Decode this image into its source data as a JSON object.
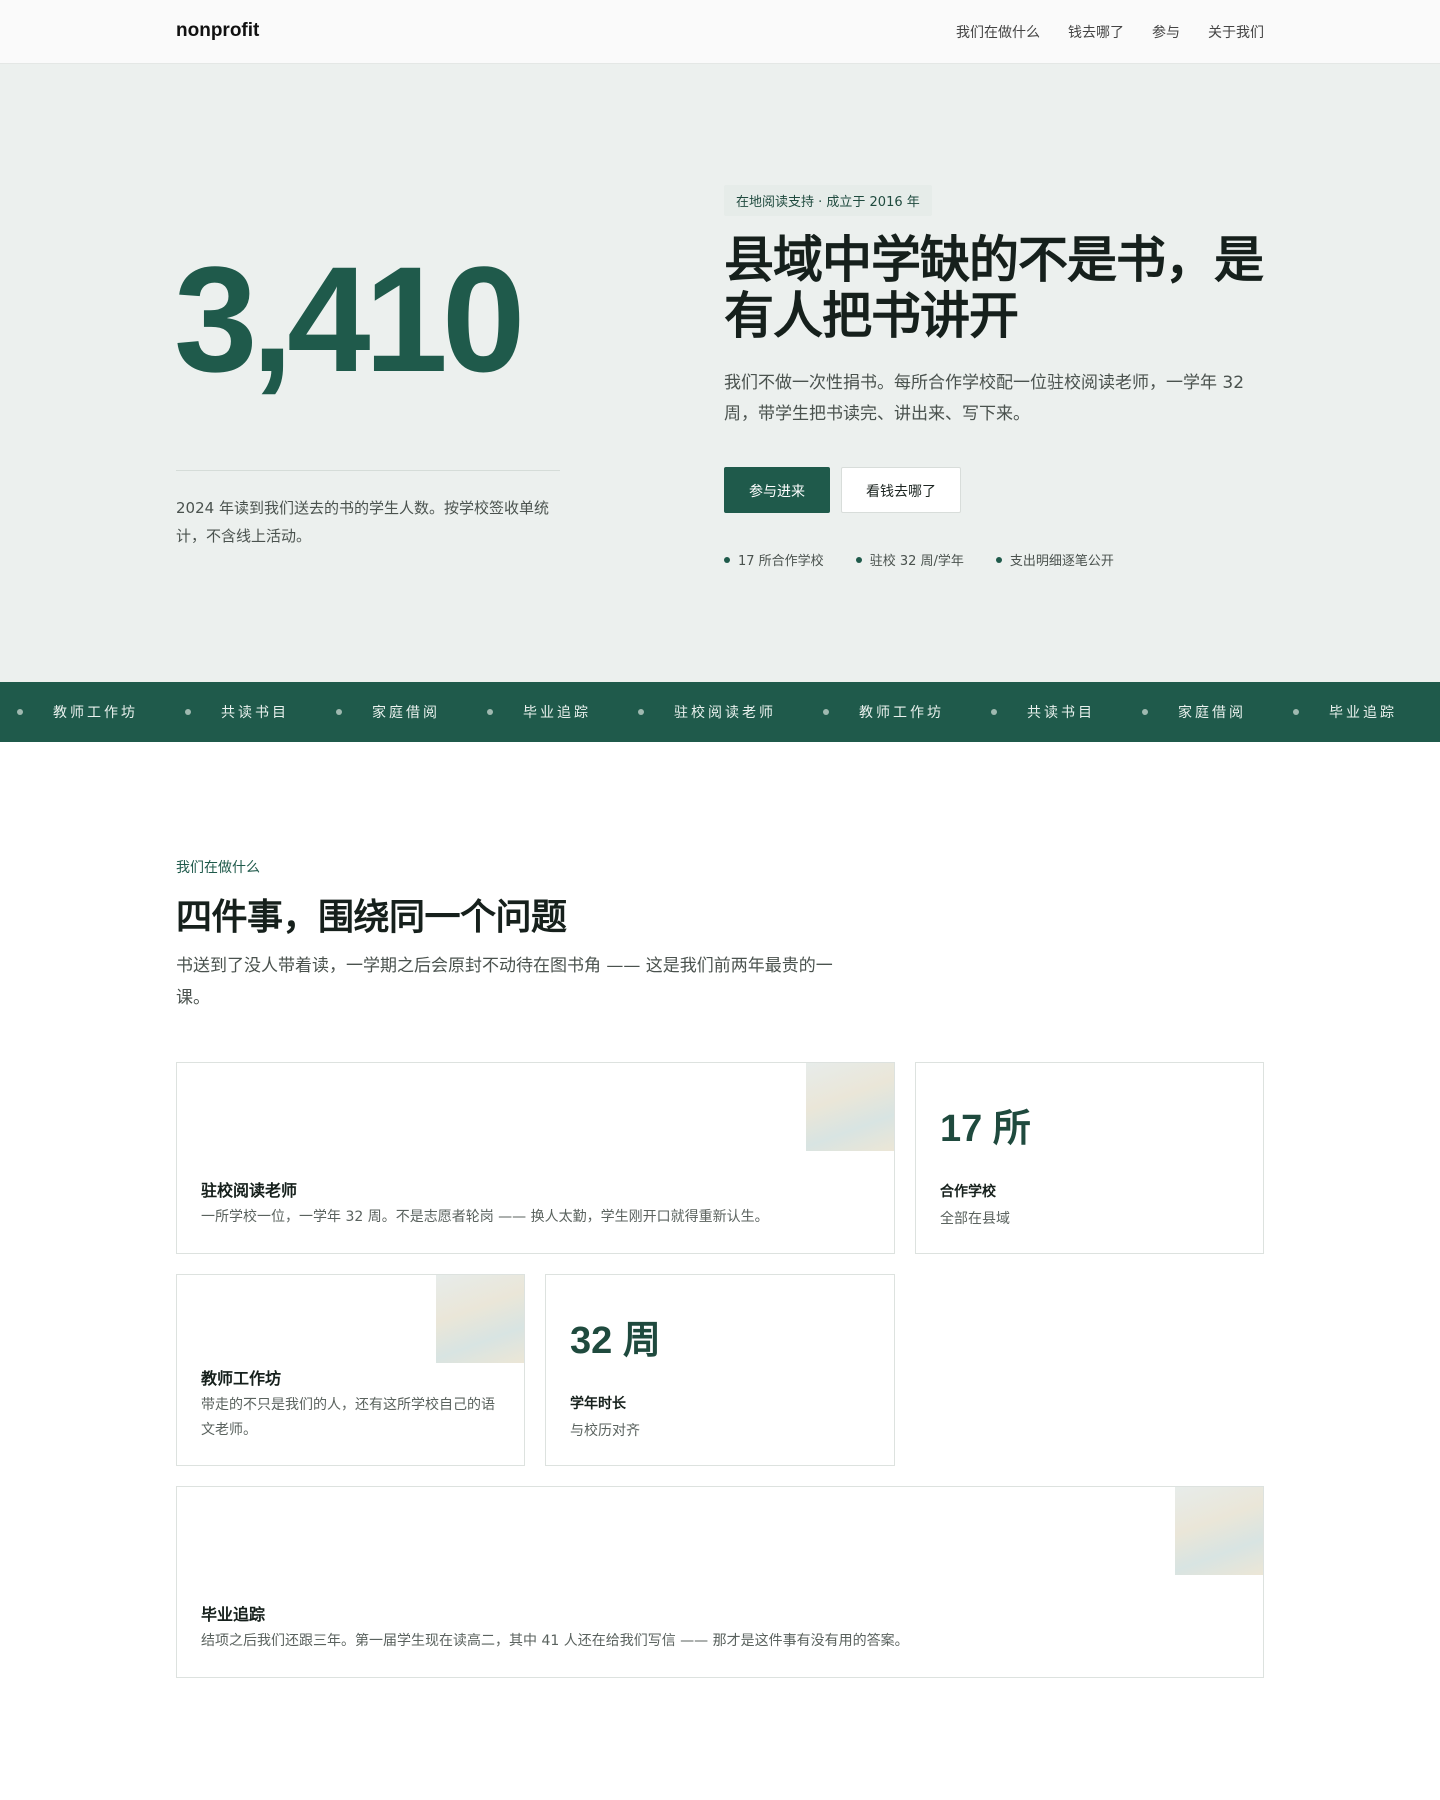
{
  "brand": "nonprofit",
  "nav": [
    "我们在做什么",
    "钱去哪了",
    "参与",
    "关于我们"
  ],
  "hero": {
    "number": "3,410",
    "number_caption": "2024 年读到我们送去的书的学生人数。按学校签收单统计，不含线上活动。",
    "eyebrow": "在地阅读支持 · 成立于 2016 年",
    "headline": "县域中学缺的不是书，是有人把书讲开",
    "lead": "我们不做一次性捐书。每所合作学校配一位驻校阅读老师，一学年 32 周，带学生把书读完、讲出来、写下来。",
    "primary_button": "参与进来",
    "secondary_button": "看钱去哪了",
    "facts": [
      "17 所合作学校",
      "驻校 32 周/学年",
      "支出明细逐笔公开"
    ]
  },
  "ticker": [
    "教师工作坊",
    "共读书目",
    "家庭借阅",
    "毕业追踪",
    "驻校阅读老师",
    "教师工作坊",
    "共读书目",
    "家庭借阅",
    "毕业追踪"
  ],
  "section": {
    "eyebrow": "我们在做什么",
    "title": "四件事，围绕同一个问题",
    "lead": "书送到了没人带着读，一学期之后会原封不动待在图书角 —— 这是我们前两年最贵的一课。"
  },
  "cards": {
    "resident": {
      "title": "驻校阅读老师",
      "text": "一所学校一位，一学年 32 周。不是志愿者轮岗 —— 换人太勤，学生刚开口就得重新认生。"
    },
    "schools": {
      "value": "17 所",
      "label": "合作学校",
      "sub": "全部在县域"
    },
    "workshop": {
      "title": "教师工作坊",
      "text": "带走的不只是我们的人，还有这所学校自己的语文老师。"
    },
    "weeks": {
      "value": "32 周",
      "label": "学年时长",
      "sub": "与校历对齐"
    },
    "tracking": {
      "title": "毕业追踪",
      "text": "结项之后我们还跟三年。第一届学生现在读高二，其中 41 人还在给我们写信 —— 那才是这件事有没有用的答案。"
    }
  }
}
